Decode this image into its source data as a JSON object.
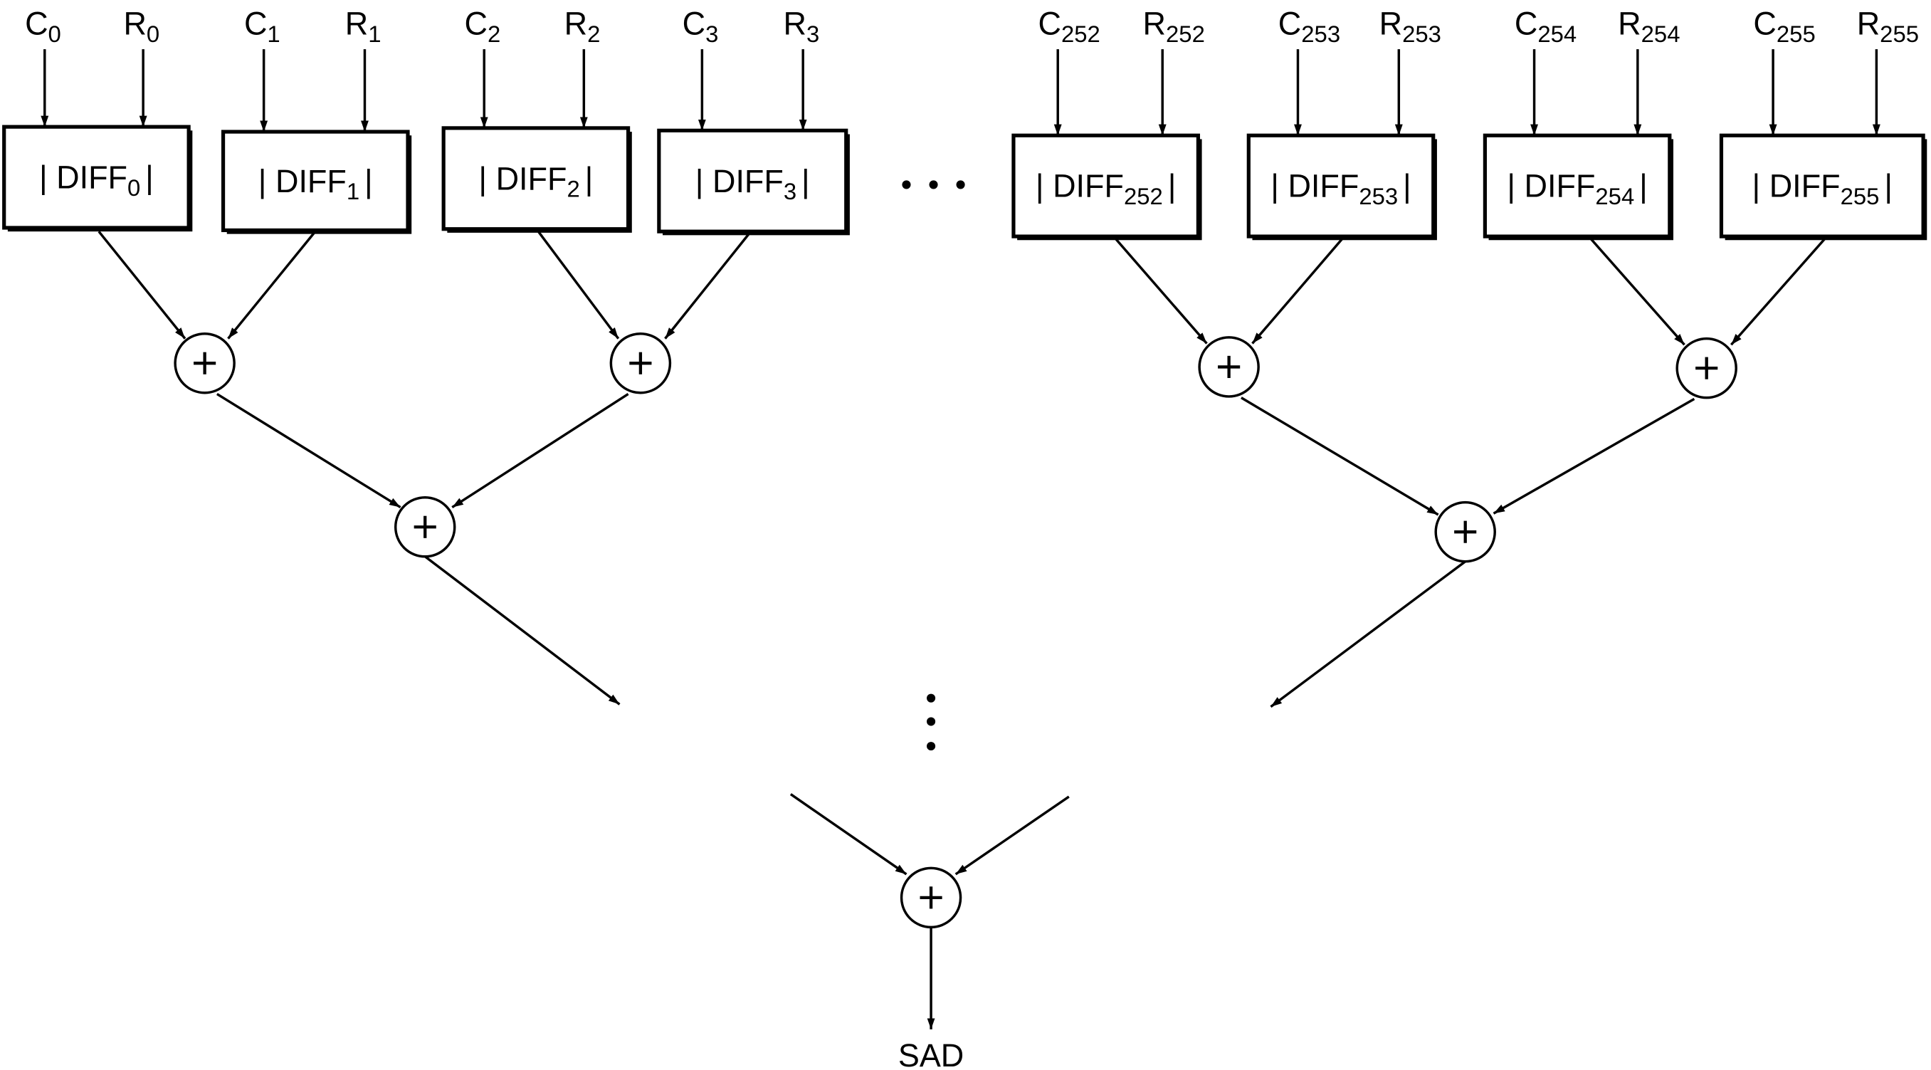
{
  "diagram": {
    "title": "",
    "inputs": [
      {
        "c": "C",
        "c_sub": "0",
        "r": "R",
        "r_sub": "0",
        "diff": "DIFF",
        "diff_sub": "0"
      },
      {
        "c": "C",
        "c_sub": "1",
        "r": "R",
        "r_sub": "1",
        "diff": "DIFF",
        "diff_sub": "1"
      },
      {
        "c": "C",
        "c_sub": "2",
        "r": "R",
        "r_sub": "2",
        "diff": "DIFF",
        "diff_sub": "2"
      },
      {
        "c": "C",
        "c_sub": "3",
        "r": "R",
        "r_sub": "3",
        "diff": "DIFF",
        "diff_sub": "3"
      },
      {
        "c": "C",
        "c_sub": "252",
        "r": "R",
        "r_sub": "252",
        "diff": "DIFF",
        "diff_sub": "252"
      },
      {
        "c": "C",
        "c_sub": "253",
        "r": "R",
        "r_sub": "253",
        "diff": "DIFF",
        "diff_sub": "253"
      },
      {
        "c": "C",
        "c_sub": "254",
        "r": "R",
        "r_sub": "254",
        "diff": "DIFF",
        "diff_sub": "254"
      },
      {
        "c": "C",
        "c_sub": "255",
        "r": "R",
        "r_sub": "255",
        "diff": "DIFF",
        "diff_sub": "255"
      }
    ],
    "abs_bar": "|",
    "adder_symbol": "+",
    "ellipsis_horizontal": "• • •",
    "output_label": "SAD"
  }
}
